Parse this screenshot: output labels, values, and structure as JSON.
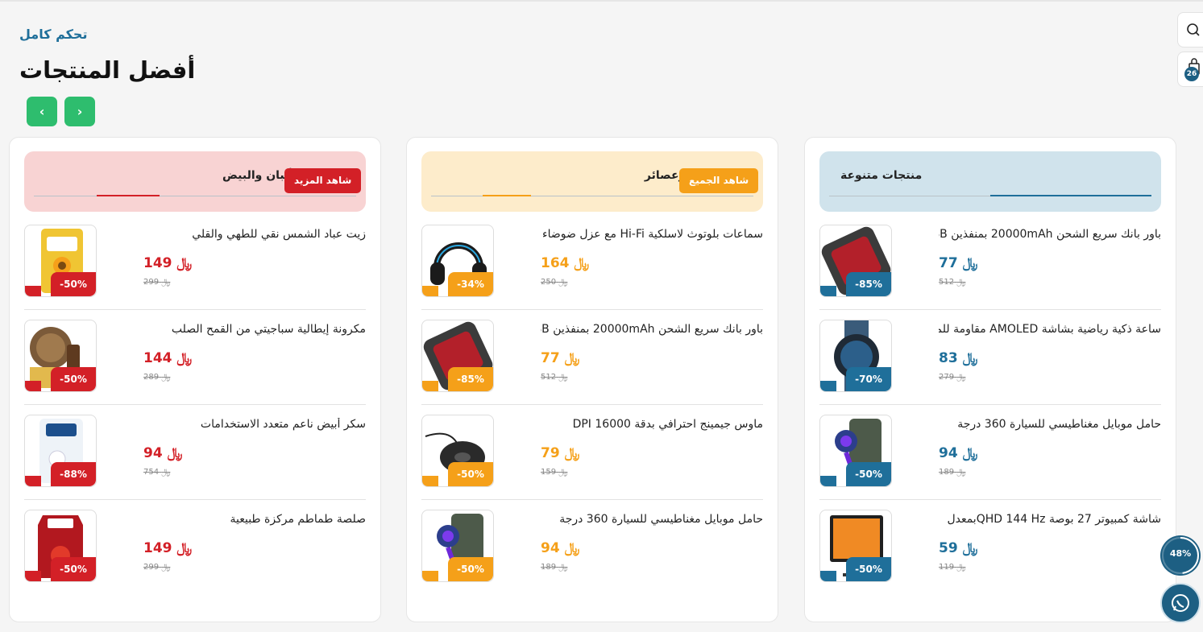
{
  "header": {
    "eyebrow": "تحكم كامل",
    "title": "أفضل المنتجات",
    "prev_icon": "‹",
    "next_icon": "›"
  },
  "side": {
    "search_icon": "search-icon",
    "cart_icon": "cart-icon",
    "cart_count": "26"
  },
  "currency": "﷼",
  "colors": {
    "blue": "#1f6f9a",
    "orange": "#f5a019",
    "red": "#d32027",
    "green": "#2ebd6e"
  },
  "panels": [
    {
      "title": "منتجات الألبان والبيض",
      "button": "شاهد المزيد",
      "items": [
        {
          "name": "زيت عباد الشمس نقي للطهي والقلي",
          "price": "149",
          "old": "299",
          "discount": "-50%"
        },
        {
          "name": "مكرونة إيطالية سباجيتي من القمح الصلب",
          "price": "144",
          "old": "289",
          "discount": "-50%"
        },
        {
          "name": "سكر أبيض ناعم متعدد الاستخدامات",
          "price": "94",
          "old": "754",
          "discount": "-88%"
        },
        {
          "name": "صلصة طماطم مركزة طبيعية",
          "price": "149",
          "old": "299",
          "discount": "-50%"
        }
      ]
    },
    {
      "title": "مشروبات وعصائر",
      "button": "شاهد الجميع",
      "items": [
        {
          "name": "سماعات بلوتوث لاسلكية Hi-Fi مع عزل ضوضاء",
          "price": "164",
          "old": "250",
          "discount": "-34%"
        },
        {
          "name": "باور بانك سريع الشحن 20000mAh بمنفذين USB",
          "price": "77",
          "old": "512",
          "discount": "-85%"
        },
        {
          "name": "ماوس جيمينج احترافي بدقة 16000 DPI",
          "price": "79",
          "old": "159",
          "discount": "-50%"
        },
        {
          "name": "حامل موبايل مغناطيسي للسيارة 360 درجة",
          "price": "94",
          "old": "189",
          "discount": "-50%"
        }
      ]
    },
    {
      "title": "منتجات متنوعة",
      "items": [
        {
          "name": "باور بانك سريع الشحن 20000mAh بمنفذين USB",
          "price": "77",
          "old": "512",
          "discount": "-85%"
        },
        {
          "name": "ساعة ذكية رياضية بشاشة AMOLED مقاومة للماء",
          "price": "83",
          "old": "279",
          "discount": "-70%"
        },
        {
          "name": "حامل موبايل مغناطيسي للسيارة 360 درجة",
          "price": "94",
          "old": "189",
          "discount": "-50%"
        },
        {
          "name": "شاشة كمبيوتر 27 بوصة QHD 144 Hzبمعدل",
          "price": "59",
          "old": "119",
          "discount": "-50%"
        }
      ]
    }
  ],
  "progress": {
    "label": "48%",
    "value": 48
  },
  "whatsapp_icon": "whatsapp-icon"
}
